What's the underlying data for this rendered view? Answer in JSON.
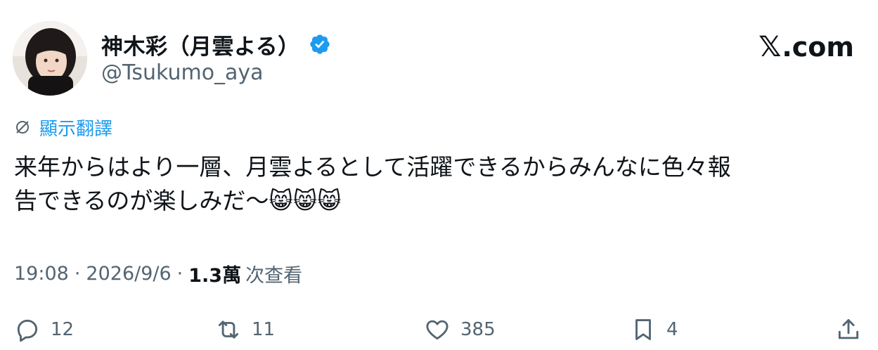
{
  "author": {
    "display_name": "神木彩（月雲よる）",
    "handle": "@Tsukumo_aya",
    "verified_color": "#1d9bf0"
  },
  "site": {
    "logo_text": ".com",
    "logo_mark": "𝕏"
  },
  "translate": {
    "label": "顯示翻譯",
    "icon": "globe-icon"
  },
  "tweet": {
    "text": "来年からはより一層、月雲よるとして活躍できるからみんなに色々報\n告できるのが楽しみだ〜😸😸😸"
  },
  "meta": {
    "time": "19:08",
    "separator": "·",
    "date": "2026/9/6",
    "views_count": "1.3萬",
    "views_label": "次查看"
  },
  "actions": {
    "reply_count": "12",
    "retweet_count": "11",
    "like_count": "385",
    "bookmark_count": "4"
  },
  "colors": {
    "text": "#0f1419",
    "secondary": "#536471",
    "accent": "#1d9bf0"
  }
}
